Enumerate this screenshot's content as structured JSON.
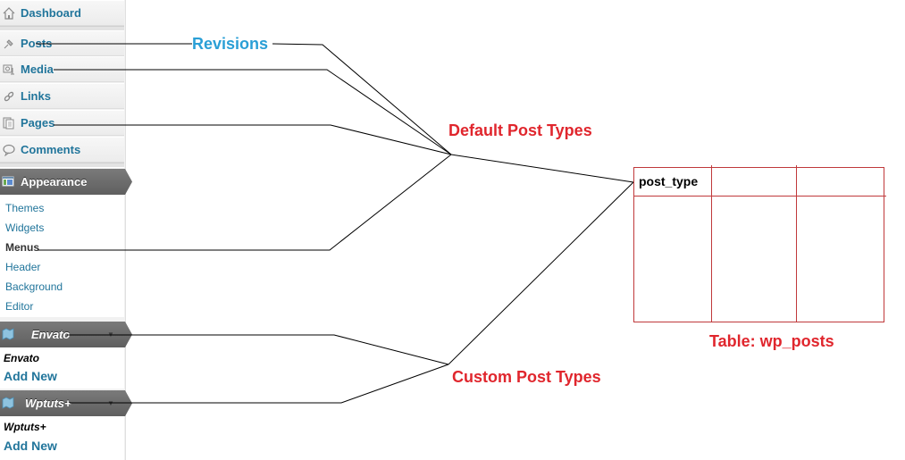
{
  "sidebar": {
    "top_items": [
      {
        "label": "Dashboard",
        "icon": "dashboard-icon"
      },
      {
        "label": "Posts",
        "icon": "pushpin-icon"
      },
      {
        "label": "Media",
        "icon": "media-icon"
      },
      {
        "label": "Links",
        "icon": "links-icon"
      },
      {
        "label": "Pages",
        "icon": "pages-icon"
      },
      {
        "label": "Comments",
        "icon": "comments-icon"
      }
    ],
    "appearance": {
      "label": "Appearance",
      "icon": "appearance-icon",
      "submenu": [
        "Themes",
        "Widgets",
        "Menus",
        "Header",
        "Background",
        "Editor"
      ],
      "current": "Menus"
    },
    "custom_menus": [
      {
        "label": "Envato",
        "icon": "custom-post-type-icon",
        "sub_title": "Envato",
        "add_new": "Add New"
      },
      {
        "label": "Wptuts+",
        "icon": "custom-post-type-icon",
        "sub_title": "Wptuts+",
        "add_new": "Add New"
      }
    ]
  },
  "callouts": {
    "revisions": "Revisions",
    "default_post_types": "Default Post Types",
    "custom_post_types": "Custom Post Types",
    "table_caption": "Table: wp_posts"
  },
  "table": {
    "columns": [
      "post_type",
      "",
      ""
    ],
    "rows": []
  },
  "colors": {
    "link_blue": "#21759b",
    "callout_blue": "#2a9fd6",
    "callout_red": "#e0262d",
    "table_border": "#c0393b",
    "menu_header_gray": "#6d6d6d"
  }
}
